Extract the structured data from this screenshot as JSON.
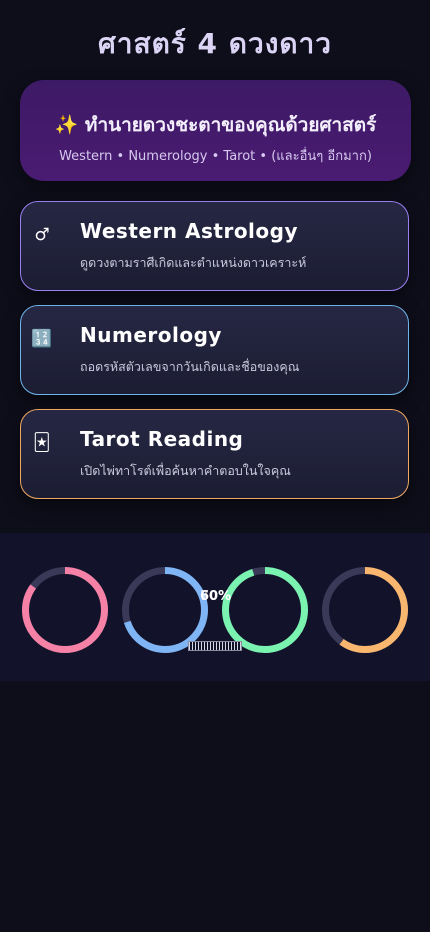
{
  "page": {
    "title": "ศาสตร์ 4 ดวงดาว"
  },
  "hero": {
    "title": "✨ ทำนายดวงชะตาของคุณด้วยศาสตร์",
    "subtitle": "Western • Numerology • Tarot • (และอื่นๆ อีกมาก)"
  },
  "cards": [
    {
      "icon": "mars-icon",
      "icon_glyph": "♂",
      "title": "Western Astrology",
      "description": "ดูดวงตามราศีเกิดและตำแหน่งดาวเคราะห์",
      "border_color": "#9b7ef2"
    },
    {
      "icon": "number-icon",
      "icon_glyph": "🔢",
      "title": "Numerology",
      "description": "ถอดรหัสตัวเลขจากวันเกิดและชื่อของคุณ",
      "border_color": "#6fb4e8"
    },
    {
      "icon": "tarot-card-icon",
      "icon_glyph": "🃏",
      "title": "Tarot Reading",
      "description": "เปิดไพ่ทาโรต์เพื่อค้นหาคำตอบในใจคุณ",
      "border_color": "#f0a860"
    }
  ],
  "rings": [
    {
      "name": "pink-ring",
      "progress": 0.85,
      "color": "#f582a6"
    },
    {
      "name": "blue-ring",
      "progress": 0.7,
      "color": "#7fb5f5"
    },
    {
      "name": "green-ring",
      "progress": 0.95,
      "color": "#7af2b0"
    },
    {
      "name": "orange-ring",
      "progress": 0.6,
      "color": "#f9b66e"
    }
  ],
  "ring_label": "60%",
  "ring_label_overlap": "70%",
  "colors": {
    "background": "#0d0e1a",
    "ring_track": "#3a3a58"
  }
}
